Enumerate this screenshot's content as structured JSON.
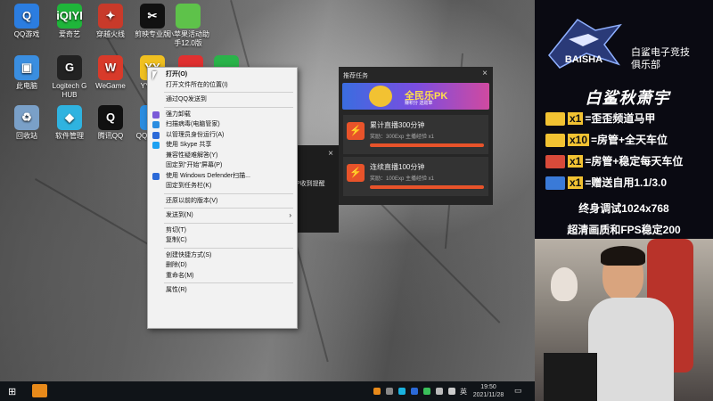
{
  "desktop": {
    "icons": [
      {
        "label": "QQ游戏",
        "color": "#2b7de0",
        "glyph": "Q"
      },
      {
        "label": "爱奇艺",
        "color": "#1fb53a",
        "glyph": "iQIYI"
      },
      {
        "label": "穿越火线",
        "color": "#c83a2a",
        "glyph": "✦"
      },
      {
        "label": "剪映专业版",
        "color": "#111111",
        "glyph": "✂"
      },
      {
        "label": "小苹果活动助手12.0版",
        "color": "#5ec24a",
        "glyph": ""
      },
      {
        "label": "此电脑",
        "color": "#3a8ee0",
        "glyph": "▣"
      },
      {
        "label": "Logitech G HUB",
        "color": "#222222",
        "glyph": "G"
      },
      {
        "label": "WeGame",
        "color": "#d83a2a",
        "glyph": "W"
      },
      {
        "label": "YY语音",
        "color": "#f0c020",
        "glyph": "YY"
      },
      {
        "label": "",
        "color": "#e03030",
        "glyph": ""
      },
      {
        "label": "",
        "color": "#2ab34a",
        "glyph": ""
      },
      {
        "label": "回收站",
        "color": "#7aa0c8",
        "glyph": "♻"
      },
      {
        "label": "软件管理",
        "color": "#2fb3e0",
        "glyph": "◆"
      },
      {
        "label": "腾讯QQ",
        "color": "#111111",
        "glyph": "Q"
      },
      {
        "label": "QQ浏览器",
        "color": "#2b8de0",
        "glyph": "Q"
      }
    ]
  },
  "context_menu": {
    "items": [
      {
        "label": "打开(O)",
        "bold": true,
        "icon": ""
      },
      {
        "label": "打开文件所在的位置(I)",
        "icon": ""
      },
      {
        "sep": true
      },
      {
        "label": "通过QQ发送到",
        "icon": ""
      },
      {
        "sep": true
      },
      {
        "label": "强力卸载",
        "icon": "#7a5ad8"
      },
      {
        "label": "扫描病毒(电脑管家)",
        "icon": "#2b8de0"
      },
      {
        "label": "以管理员身份运行(A)",
        "icon": "#2b6ad8"
      },
      {
        "label": "使用 Skype 共享",
        "icon": "#1da1f2"
      },
      {
        "label": "兼容性疑难解答(Y)",
        "icon": ""
      },
      {
        "label": "固定到\"开始\"屏幕(P)",
        "icon": ""
      },
      {
        "label": "使用 Windows Defender扫描...",
        "icon": "#2b6ad8"
      },
      {
        "label": "固定到任务栏(K)",
        "icon": ""
      },
      {
        "sep": true
      },
      {
        "label": "还原以前的版本(V)",
        "icon": ""
      },
      {
        "sep": true
      },
      {
        "label": "发送到(N)",
        "icon": "",
        "submenu": true
      },
      {
        "sep": true
      },
      {
        "label": "剪切(T)",
        "icon": ""
      },
      {
        "label": "复制(C)",
        "icon": ""
      },
      {
        "sep": true
      },
      {
        "label": "创建快捷方式(S)",
        "icon": ""
      },
      {
        "label": "删除(D)",
        "icon": ""
      },
      {
        "label": "重命名(M)",
        "icon": ""
      },
      {
        "sep": true
      },
      {
        "label": "属性(R)",
        "icon": ""
      }
    ]
  },
  "notify_popup": {
    "text": "P收到提醒",
    "close": "×"
  },
  "task_panel": {
    "title": "推荐任务",
    "close": "×",
    "banner": {
      "title": "全民乐PK",
      "subtitle": "赚积分 送勋章"
    },
    "tasks": [
      {
        "title": "累计直播300分钟",
        "reward": "奖励：300Exp 主播经验 x1",
        "progress": 1.0
      },
      {
        "title": "连续直播100分钟",
        "reward": "奖励：100Exp 主播经验 x1",
        "progress": 1.0
      }
    ]
  },
  "taskbar": {
    "start_icon": "⊞",
    "lang": "英",
    "time": "19:50",
    "date": "2021/11/28",
    "notif_icon": "▭"
  },
  "stream_overlay": {
    "club_name_line1": "白鲨电子竞技",
    "club_name_line2": "俱乐部",
    "logo_text": "BAISHA",
    "streamer_title": "白鲨秋萧宇",
    "offers": [
      {
        "qty": "x1",
        "text": "=歪歪频道马甲",
        "chip": "#f2c232"
      },
      {
        "qty": "x10",
        "text": "=房管+全天车位",
        "chip": "#f2c232"
      },
      {
        "qty": "x1",
        "text": "=房管+稳定每天车位",
        "chip": "#d84a3a"
      },
      {
        "qty": "x1",
        "text": "=赠送自用1.1/3.0",
        "chip": "#3a7ad8"
      }
    ],
    "line1": "终身调试1024x768",
    "line2": "超清画质和FPS稳定200"
  }
}
